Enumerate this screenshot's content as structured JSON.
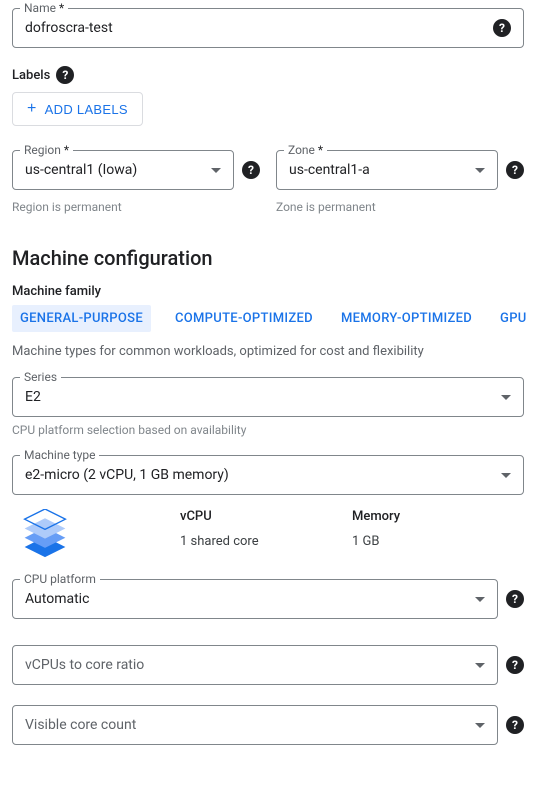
{
  "name": {
    "label": "Name",
    "value": "dofroscra-test"
  },
  "labels": {
    "heading": "Labels",
    "add_button": "ADD LABELS"
  },
  "region": {
    "label": "Region",
    "value": "us-central1 (Iowa)",
    "helper": "Region is permanent"
  },
  "zone": {
    "label": "Zone",
    "value": "us-central1-a",
    "helper": "Zone is permanent"
  },
  "machine_config": {
    "title": "Machine configuration",
    "family_label": "Machine family",
    "tabs": {
      "general": "GENERAL-PURPOSE",
      "compute": "COMPUTE-OPTIMIZED",
      "memory": "MEMORY-OPTIMIZED",
      "gpu": "GPU"
    },
    "tab_desc": "Machine types for common workloads, optimized for cost and flexibility",
    "series": {
      "label": "Series",
      "value": "E2",
      "helper": "CPU platform selection based on availability"
    },
    "machine_type": {
      "label": "Machine type",
      "value": "e2-micro (2 vCPU, 1 GB memory)"
    },
    "specs": {
      "vcpu_label": "vCPU",
      "vcpu_value": "1 shared core",
      "memory_label": "Memory",
      "memory_value": "1 GB"
    },
    "cpu_platform": {
      "label": "CPU platform",
      "value": "Automatic"
    },
    "vcpu_ratio": {
      "label": "vCPUs to core ratio"
    },
    "visible_cores": {
      "label": "Visible core count"
    }
  }
}
